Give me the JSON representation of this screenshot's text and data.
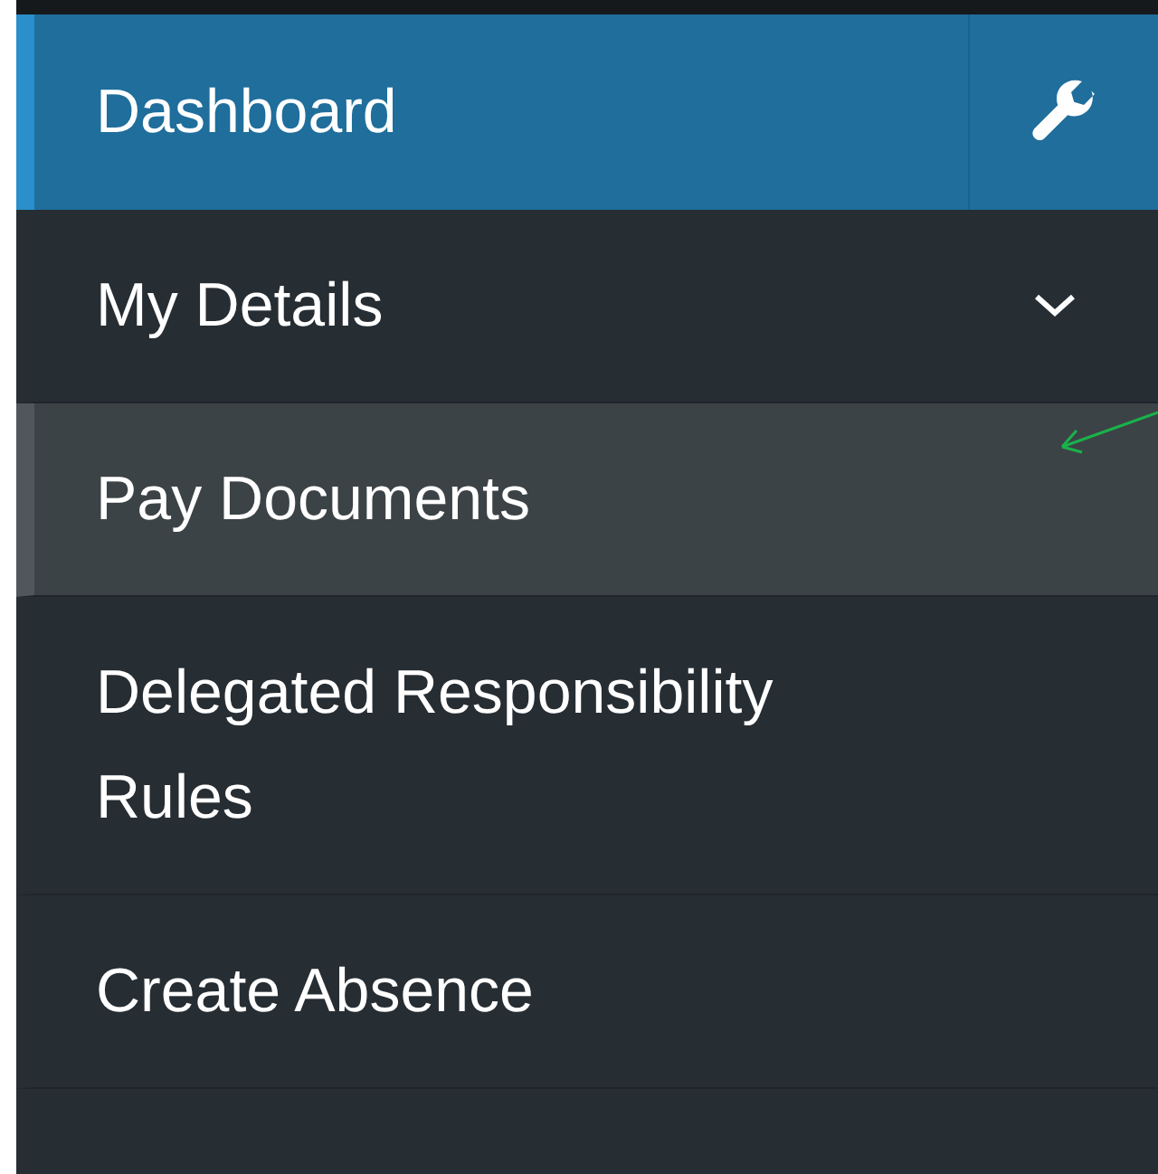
{
  "menu": [
    {
      "label": "Dashboard",
      "kind": "tools",
      "selected": true,
      "hovered": false
    },
    {
      "label": "My Details",
      "kind": "expandable",
      "selected": false,
      "hovered": false
    },
    {
      "label": "Pay Documents",
      "kind": "link",
      "selected": false,
      "hovered": true
    },
    {
      "label": "Delegated Responsibility Rules",
      "kind": "link",
      "selected": false,
      "hovered": false
    },
    {
      "label": "Create Absence",
      "kind": "link",
      "selected": false,
      "hovered": false
    }
  ]
}
